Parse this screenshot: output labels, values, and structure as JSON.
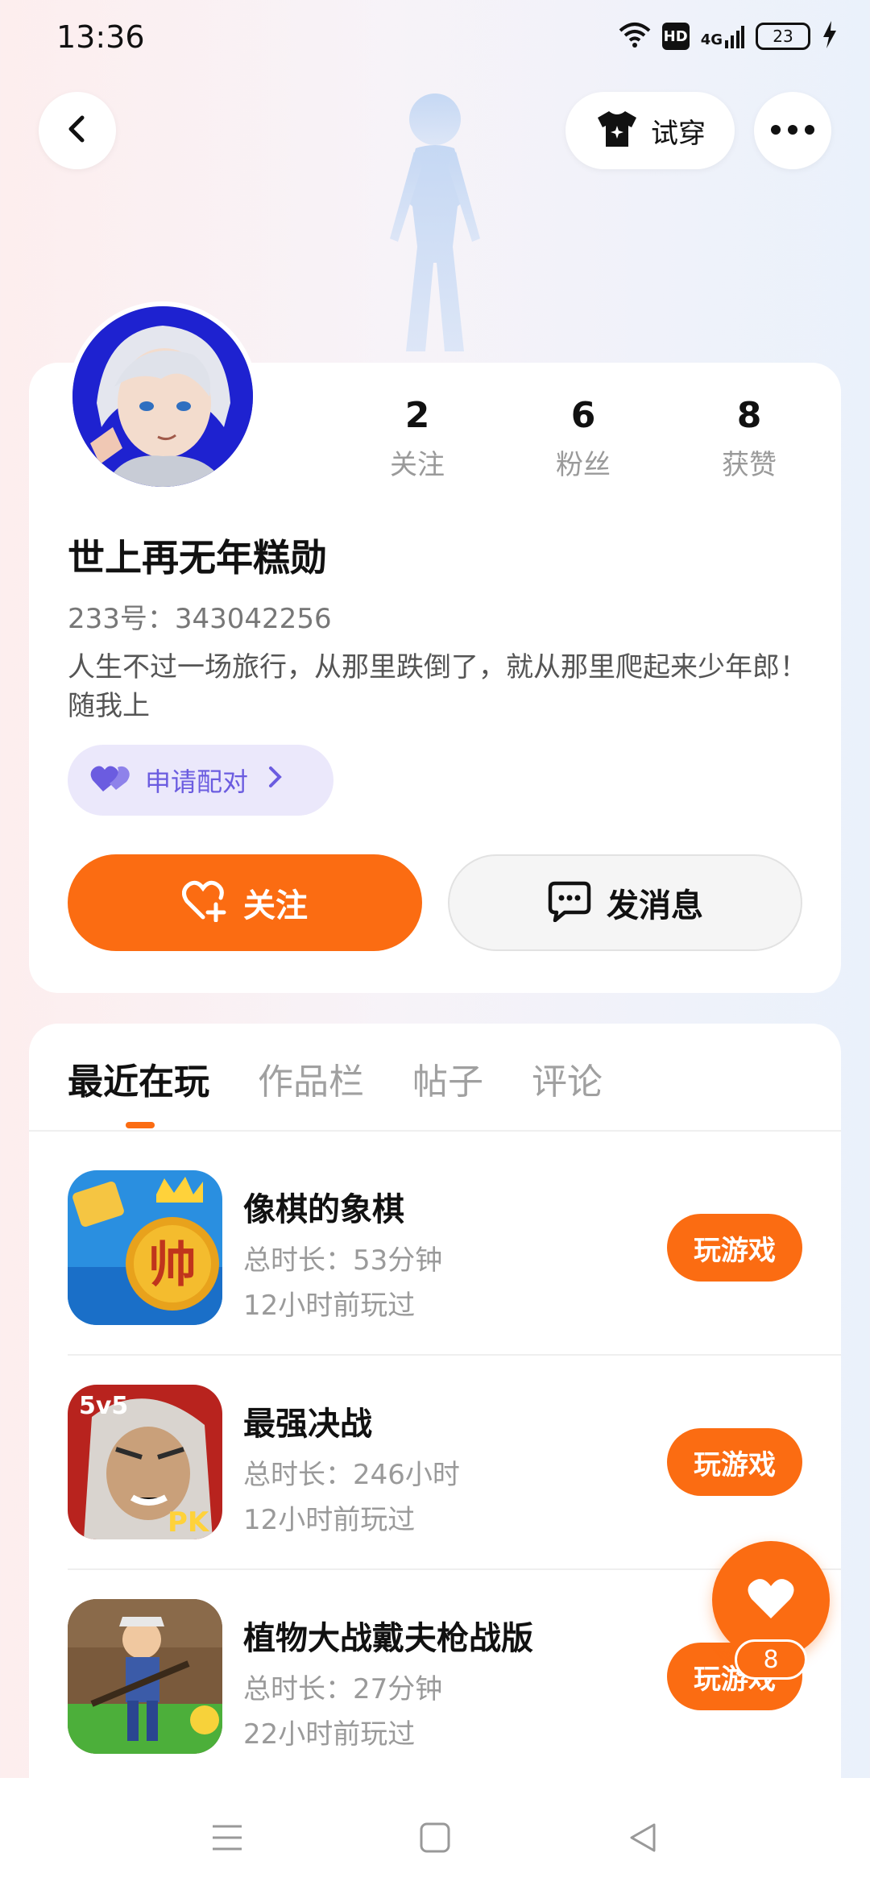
{
  "status_bar": {
    "time": "13:36",
    "hd": "HD",
    "network": "4G",
    "battery": "23"
  },
  "header": {
    "try_on_label": "试穿"
  },
  "profile": {
    "stats": [
      {
        "value": "2",
        "label": "关注"
      },
      {
        "value": "6",
        "label": "粉丝"
      },
      {
        "value": "8",
        "label": "获赞"
      }
    ],
    "username": "世上再无年糕勋",
    "user_id": "233号：343042256",
    "bio": "人生不过一场旅行，从那里跌倒了，就从那里爬起来少年郎！随我上",
    "pair_label": "申请配对",
    "follow_label": "关注",
    "message_label": "发消息"
  },
  "tabs": [
    "最近在玩",
    "作品栏",
    "帖子",
    "评论"
  ],
  "games": [
    {
      "title": "像棋的象棋",
      "duration": "总时长：53分钟",
      "last_played": "12小时前玩过",
      "play_label": "玩游戏"
    },
    {
      "title": "最强决战",
      "duration": "总时长：246小时",
      "last_played": "12小时前玩过",
      "play_label": "玩游戏"
    },
    {
      "title": "植物大战戴夫枪战版",
      "duration": "总时长：27分钟",
      "last_played": "22小时前玩过",
      "play_label": "玩游戏"
    }
  ],
  "game_icon_texts": {
    "icon2_badge": "5v5",
    "icon2_pk": "PK",
    "icon1_glyph": "帅"
  },
  "floating_like": {
    "count": "8"
  },
  "colors": {
    "accent": "#fb6c12",
    "pair_bg": "#ebe8fb",
    "pair_text": "#6b5ce0"
  }
}
